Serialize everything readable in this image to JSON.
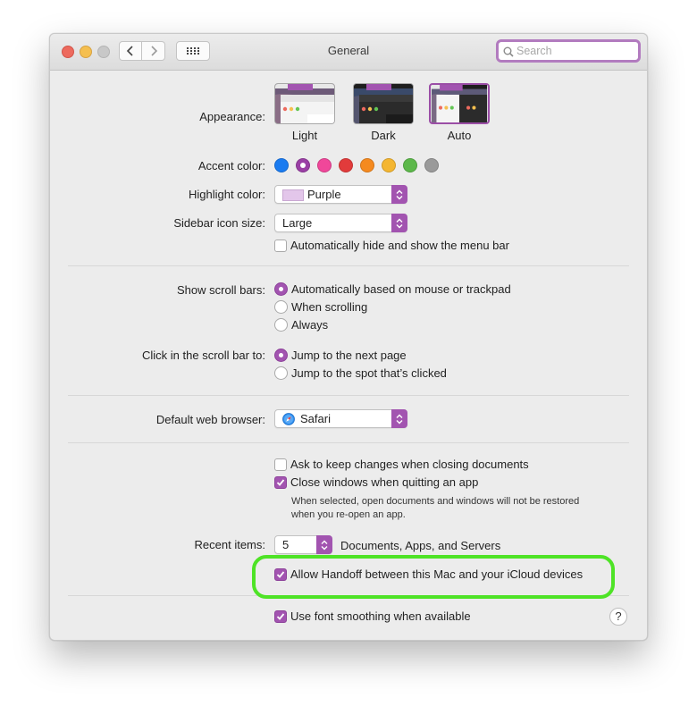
{
  "window": {
    "title": "General"
  },
  "search": {
    "placeholder": "Search"
  },
  "appearance": {
    "label": "Appearance:",
    "options": [
      {
        "name": "Light",
        "selected": false
      },
      {
        "name": "Dark",
        "selected": false
      },
      {
        "name": "Auto",
        "selected": true
      }
    ]
  },
  "accent": {
    "label": "Accent color:",
    "colors": [
      "#1a7bf0",
      "#9a3fa5",
      "#f0479a",
      "#e23b3b",
      "#f58a1f",
      "#f4b631",
      "#5cb84a",
      "#9a9a9a"
    ],
    "selected_index": 1
  },
  "highlight": {
    "label": "Highlight color:",
    "value": "Purple",
    "swatch": "#e3c6ea"
  },
  "sidebar_icon": {
    "label": "Sidebar icon size:",
    "value": "Large"
  },
  "menu_bar": {
    "label": "Automatically hide and show the menu bar",
    "checked": false
  },
  "scroll_bars": {
    "label": "Show scroll bars:",
    "options": [
      {
        "label": "Automatically based on mouse or trackpad",
        "selected": true
      },
      {
        "label": "When scrolling",
        "selected": false
      },
      {
        "label": "Always",
        "selected": false
      }
    ]
  },
  "click_scroll": {
    "label": "Click in the scroll bar to:",
    "options": [
      {
        "label": "Jump to the next page",
        "selected": true
      },
      {
        "label": "Jump to the spot that’s clicked",
        "selected": false
      }
    ]
  },
  "browser": {
    "label": "Default web browser:",
    "value": "Safari"
  },
  "documents": {
    "ask_keep": {
      "label": "Ask to keep changes when closing documents",
      "checked": false
    },
    "close_windows": {
      "label": "Close windows when quitting an app",
      "checked": true
    },
    "note_line1": "When selected, open documents and windows will not be restored",
    "note_line2": "when you re-open an app."
  },
  "recent": {
    "label": "Recent items:",
    "value": "5",
    "suffix": "Documents, Apps, and Servers"
  },
  "handoff": {
    "label": "Allow Handoff between this Mac and your iCloud devices",
    "checked": true,
    "ring_color": "#4ee326"
  },
  "font_smoothing": {
    "label": "Use font smoothing when available",
    "checked": true
  },
  "help": {
    "label": "?"
  },
  "colors": {
    "accent": "#a254b0"
  }
}
